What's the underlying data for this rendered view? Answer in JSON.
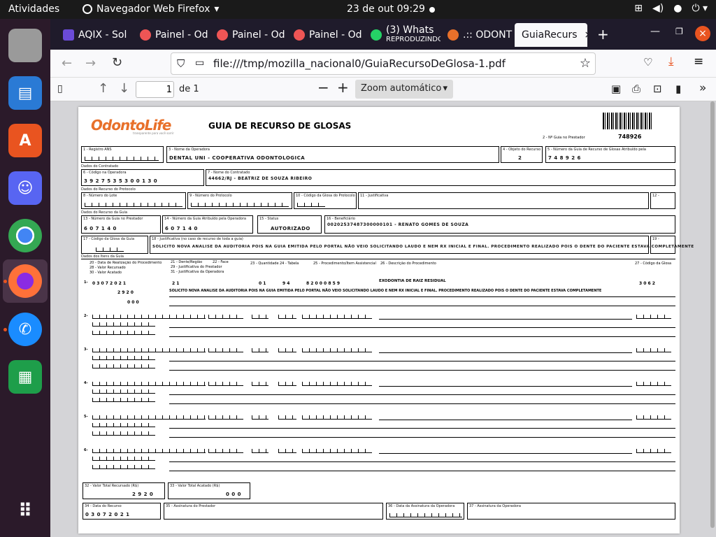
{
  "topbar": {
    "activities": "Atividades",
    "app_name": "Navegador Web Firefox",
    "clock": "23 de out  09:29"
  },
  "tabs": [
    {
      "label": "AQIX - Sol",
      "color": "#6b4bd8"
    },
    {
      "label": "Painel - Od",
      "color": "#e55"
    },
    {
      "label": "Painel - Od",
      "color": "#e55"
    },
    {
      "label": "Painel - Od",
      "color": "#e55"
    },
    {
      "label": "(3) Whats",
      "sub": "REPRODUZINDO",
      "color": "#25d366"
    },
    {
      "label": ".:: ODONT",
      "color": "#e8702a"
    },
    {
      "label": "GuiaRecurs",
      "color": "#888"
    }
  ],
  "url": "file:///tmp/mozilla_nacional0/GuiaRecursoDeGlosa-1.pdf",
  "pdf": {
    "page_input": "1",
    "page_total": "de 1",
    "zoom": "Zoom automático"
  },
  "doc": {
    "logo": "OdontoLife",
    "logo_tag": "transparente para você sorrir",
    "title": "GUIA DE RECURSO DE GLOSAS",
    "guia_prestador_label": "2 - Nº Guia no Prestador",
    "guia_prestador": "748926",
    "f1": "1 - Registro ANS",
    "f3": "3 - Nome da Operadora",
    "operadora": "DENTAL UNI - COOPERATIVA ODONTOLOGICA",
    "f4": "4 - Objeto do Recurso",
    "objeto": "2",
    "f5": "5 - Número da Guia de Recurso de Glosas Atribuído pela",
    "num_recurso": "7 4 8 9 2 6",
    "sec_contratado": "Dados do Contratado",
    "f6": "6 - Código na Operadora",
    "cod_operadora": "3 9 2 7 5 3 5 3 0 0 1 3 0",
    "f7": "7 - Nome do Contratado",
    "nome_contratado": "44662/RJ - BEATRIZ DE SOUZA RIBEIRO",
    "sec_recurso_protocolo": "Dados do Recurso do Protocolo",
    "f8": "8 - Número do Lote",
    "f9": "9 - Número do Protocolo",
    "f10": "10 - Código da Glosa do Protocolo",
    "f11": "11 - Justificativa",
    "f12": "12 -",
    "sec_recurso_guia": "Dados do Recurso da Guia",
    "f13": "13 - Número da Guia no Prestador",
    "guia_prest_val": "6 0 7 1 4 0",
    "f14": "14 - Número da Guia Atribuído pela Operadora",
    "guia_oper_val": "6 0 7 1 4 0",
    "f15": "15 - Status",
    "status": "AUTORIZADO",
    "f16": "16 - Beneficiário",
    "beneficiario": "00202537487300000101 - RENATO GOMES DE SOUZA",
    "f17": "17 - Código da Glosa da Guia",
    "f18": "18 - Justificativa (no caso de recurso de toda a guia)",
    "justificativa": "SOLICITO NOVA ANALISE DA AUDITORIA POIS NA GUIA EMITIDA PELO PORTAL NÃO VEIO SOLICITANDO LAUDO E NEM RX INICIAL E FINAL. PROCEDIMENTO REALIZADO POIS O DENTE DO PACIENTE ESTAVA COMPLETAMENTE",
    "f19": "19 -",
    "sec_itens": "Dados dos Itens da Guia",
    "h20": "20 - Data de Realização do Procedimento",
    "h28": "28 - Valor Recursado",
    "h30": "30 - Valor Acatado",
    "h21": "21 - Dente/Região",
    "h29": "29 - Justificativa do Prestador",
    "h31": "31 - Justificativa da Operadora",
    "h22": "22 - Face",
    "h23": "23 - Quantidade",
    "h24": "24 - Tabela",
    "h25": "25 - Procedimento/Item Assistencial",
    "h26": "26 - Descrição do Procedimento",
    "h27": "27 - Código da Glosa",
    "item1_date": "0 3 0 7 2 0 2 1",
    "item1_dente": "2 1",
    "item1_qtd": "0 1",
    "item1_tab": "9 4",
    "item1_proc": "8 2 0 0 0 8 5 9",
    "item1_desc": "EXODONTIA DE RAIZ RESIDUAL",
    "item1_glosa": "3 0 6 2",
    "item1_valor": "2 9 2 0",
    "item1_acatado": "0 0 0",
    "item1_just": "SOLICITO NOVA ANALISE DA AUDITORIA POIS NA GUIA EMITIDA PELO PORTAL NÃO VEIO SOLICITANDO LAUDO E NEM RX INICIAL E FINAL. PROCEDIMENTO REALIZADO POIS O DENTE DO PACIENTE ESTAVA COMPLETAMENTE",
    "row_nums": [
      "1-",
      "2-",
      "3-",
      "4-",
      "5-",
      "6-"
    ],
    "f32": "32 - Valor Total Recursado (R$)",
    "total_recursado": "2 9 2 0",
    "f33": "33 - Valor Total Acatado (R$)",
    "total_acatado": "0 0 0",
    "f34": "34 - Data do Recurso",
    "data_recurso": "0 3 0 7 2 0 2 1",
    "f35": "35 - Assinatura do Prestador",
    "f36": "36 - Data da Assinatura da Operadora",
    "f37": "37 - Assinatura da Operadora"
  }
}
